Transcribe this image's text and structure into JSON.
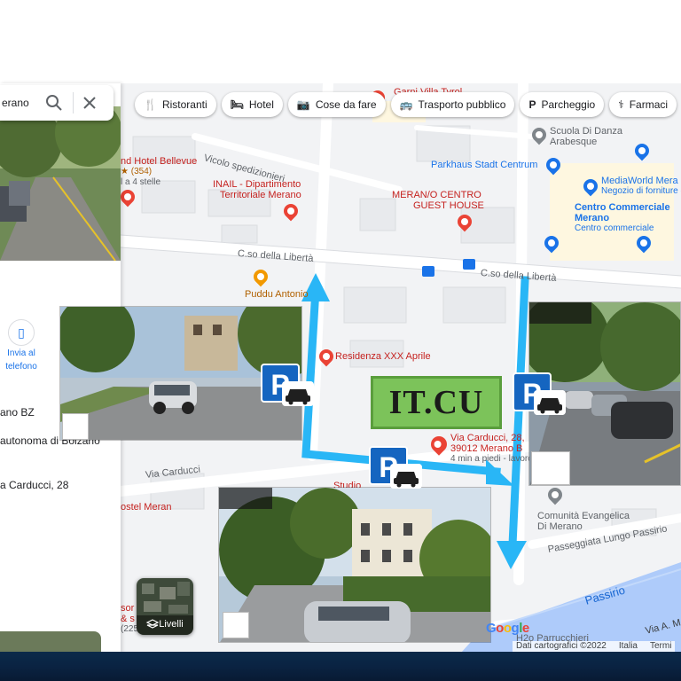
{
  "search": {
    "query": "erano",
    "search_icon": "search-icon",
    "close_icon": "close-icon"
  },
  "chips": [
    {
      "label": "Ristoranti",
      "icon": "utensils-icon",
      "glyph": "🍴"
    },
    {
      "label": "Hotel",
      "icon": "bed-icon",
      "glyph": "🛏"
    },
    {
      "label": "Cose da fare",
      "icon": "camera-icon",
      "glyph": "📷"
    },
    {
      "label": "Trasporto pubblico",
      "icon": "bus-icon",
      "glyph": "🚌"
    },
    {
      "label": "Parcheggio",
      "icon": "parking-icon",
      "glyph": "P"
    },
    {
      "label": "Farmaci",
      "icon": "pharmacy-icon",
      "glyph": "⚕"
    }
  ],
  "sidebar": {
    "send_to_phone": {
      "line1": "Invia al",
      "line2": "telefono"
    },
    "address_lines": [
      "ano BZ",
      "autonoma di Bolzano",
      "a Carducci, 28"
    ]
  },
  "map": {
    "roads": {
      "vicolo": "Vicolo spedizionieri",
      "corso_left": "C.so della Libertà",
      "corso_right": "C.so della Libertà",
      "carducci": "Via Carducci",
      "lungo_passirio": "Passeggiata Lungo Passirio",
      "river": "Passirio",
      "via_a": "Via A. M"
    },
    "pois": {
      "garni": "Garni Villa Tyrol",
      "hotel_bellevue": "nd Hotel Bellevue",
      "bellevue_rating": "★ (354)",
      "bellevue_stars": "l a 4 stelle",
      "inail_1": "INAIL - Dipartimento",
      "inail_2": "Territoriale Merano",
      "meran_1": "MERAN/O CENTRO",
      "meran_2": "GUEST HOUSE",
      "scuola_1": "Scuola Di Danza",
      "scuola_2": "Arabesque",
      "parkhaus": "Parkhaus Stadt Centrum",
      "mediaworld_1": "MediaWorld Mera",
      "mediaworld_2": "Negozio di forniture el",
      "centro_1": "Centro Commerciale",
      "centro_2": "Merano",
      "centro_3": "Centro commerciale",
      "puddu": "Puddu Antonio",
      "residenza": "Residenza XXX Aprile",
      "dest_1": "Via Carducci, 28,",
      "dest_2": "39012 Merano B",
      "dest_3": "4 min a piedi - lavoro",
      "studio": "Studio",
      "hostel": "ostel Meran",
      "comunita_1": "Comunità Evangelica",
      "comunita_2": "Di Merano",
      "sor_1": "sor",
      "sor_2": "& s",
      "sor_3": "(225",
      "h2o": "H2o Parrucchieri"
    }
  },
  "logo_badge": "IT.CU",
  "layers": {
    "label": "Livelli",
    "icon": "layers-icon"
  },
  "attribution": {
    "data": "Dati cartografici ©2022",
    "country": "Italia",
    "terms": "Termi",
    "brand": "Google"
  },
  "colors": {
    "arrow": "#29b6f6",
    "parking_blue": "#1565c0",
    "logo_green": "#7cc35a",
    "pin_red": "#ea4335",
    "poi_blue": "#1a73e8"
  }
}
